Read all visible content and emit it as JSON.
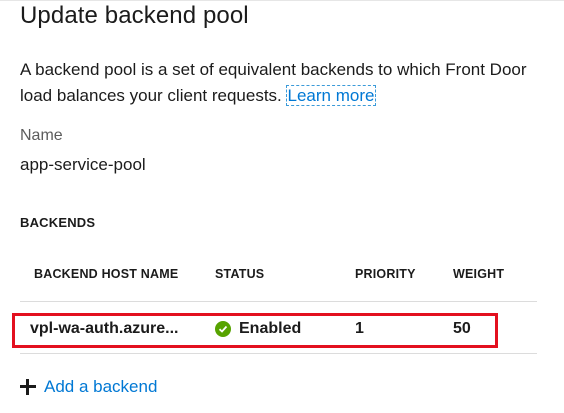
{
  "panel": {
    "title": "Update backend pool",
    "description": "A backend pool is a set of equivalent backends to which Front Door load balances your client requests.",
    "learn_more": "Learn more"
  },
  "name": {
    "label": "Name",
    "value": "app-service-pool"
  },
  "backends": {
    "section_title": "BACKENDS",
    "columns": [
      "BACKEND HOST NAME",
      "STATUS",
      "PRIORITY",
      "WEIGHT"
    ],
    "rows": [
      {
        "host": "vpl-wa-auth.azure...",
        "status": "Enabled",
        "priority": "1",
        "weight": "50"
      }
    ],
    "add_label": "Add a backend"
  },
  "colors": {
    "accent": "#0078d4",
    "enabled": "#57a300",
    "highlight": "#e3101f"
  },
  "icons": {
    "status": "check-circle-icon",
    "add": "plus-icon"
  }
}
